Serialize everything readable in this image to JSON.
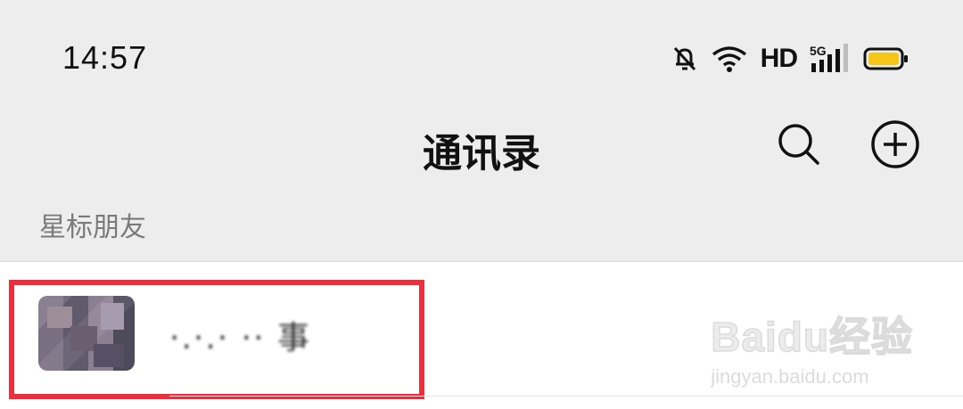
{
  "status_bar": {
    "time": "14:57",
    "network_label": "HD",
    "cellular_label": "5G",
    "battery_color": "#f5c518"
  },
  "nav": {
    "title": "通讯录",
    "search_icon": "search-icon",
    "add_icon": "plus-circle-icon"
  },
  "section": {
    "title": "星标朋友"
  },
  "contacts": [
    {
      "name": "·.·.·   ·· 事",
      "avatar": "blurred-avatar"
    }
  ],
  "highlight_color": "#e8303f",
  "watermark": {
    "logo": "Baidu经验",
    "url": "jingyan.baidu.com"
  }
}
